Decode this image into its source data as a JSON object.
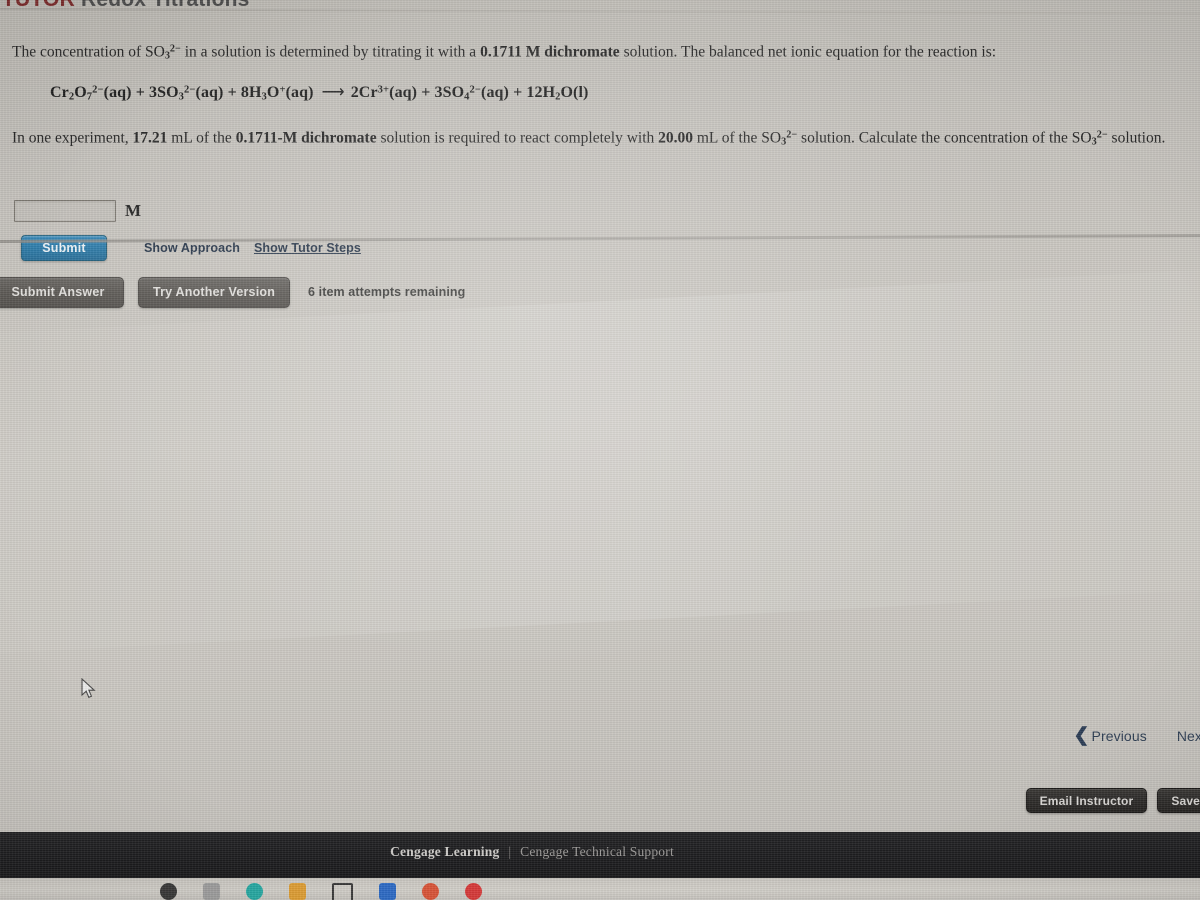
{
  "header": {
    "tutor_label": "TUTOR",
    "topic": "Redox Titrations"
  },
  "question": {
    "paragraph_1_part_a": "The concentration of SO",
    "paragraph_1_sub_1": "3",
    "paragraph_1_sup_1": "2−",
    "paragraph_1_part_b": " in a solution is determined by titrating it with a ",
    "paragraph_1_bold_1": "0.1711 M dichromate",
    "paragraph_1_part_c": " solution. The balanced net ionic equation for the reaction is:",
    "equation_text": "Cr2O7 2−(aq) + 3SO3 2−(aq) + 8H3O+(aq) ⟶ 2Cr3+(aq) + 3SO4 2−(aq) + 12H2O(l)",
    "paragraph_2_part_a": "In one experiment, ",
    "paragraph_2_bold_1": "17.21",
    "paragraph_2_part_b": " mL of the ",
    "paragraph_2_bold_2": "0.1711-M dichromate",
    "paragraph_2_part_c": " solution is required to react completely with ",
    "paragraph_2_bold_3": "20.00",
    "paragraph_2_part_d": " mL of the SO",
    "paragraph_2_sub_1": "3",
    "paragraph_2_sup_1": "2−",
    "paragraph_2_part_e": " solution. Calculate the concentration of the SO",
    "paragraph_2_sub_2": "3",
    "paragraph_2_sup_2": "2−",
    "paragraph_2_part_f": " solution."
  },
  "answer": {
    "input_value": "",
    "input_placeholder": "",
    "unit": "M"
  },
  "buttons": {
    "submit": "Submit",
    "show_approach": "Show Approach",
    "show_tutor_steps": "Show Tutor Steps",
    "submit_answer": "Submit Answer",
    "try_another_version": "Try Another Version",
    "email_instructor": "Email Instructor",
    "save": "Save"
  },
  "status": {
    "attempts_remaining": "6 item attempts remaining"
  },
  "navigation": {
    "previous": "Previous",
    "next": "Next",
    "chevron_left_icon": "❮"
  },
  "footer": {
    "company": "Cengage Learning",
    "separator": "|",
    "support": "Cengage Technical Support"
  },
  "dock": {
    "icons": [
      {
        "name": "dock-icon-dark-circle",
        "color": "#2b2b2b",
        "shape": "circle"
      },
      {
        "name": "dock-icon-grid",
        "color": "#9a9a9a",
        "shape": "square"
      },
      {
        "name": "dock-icon-teal-circle",
        "color": "#19a6a0",
        "shape": "circle"
      },
      {
        "name": "dock-icon-orange-square",
        "color": "#e09a28",
        "shape": "square"
      },
      {
        "name": "dock-icon-window-outline",
        "color": "#2d2d2d",
        "shape": "outline"
      },
      {
        "name": "dock-icon-blue-diamond",
        "color": "#1f63c4",
        "shape": "square"
      },
      {
        "name": "dock-icon-red-orange",
        "color": "#d94a2b",
        "shape": "circle"
      },
      {
        "name": "dock-icon-red-circle",
        "color": "#d62c2c",
        "shape": "circle"
      }
    ]
  },
  "colors": {
    "accent_blue": "#2f7dab",
    "tutor_red": "#7c2b2b",
    "dark_button": "#5d5a56",
    "black_button": "#2e2c2a",
    "footer_bg": "#1d1d1f"
  }
}
